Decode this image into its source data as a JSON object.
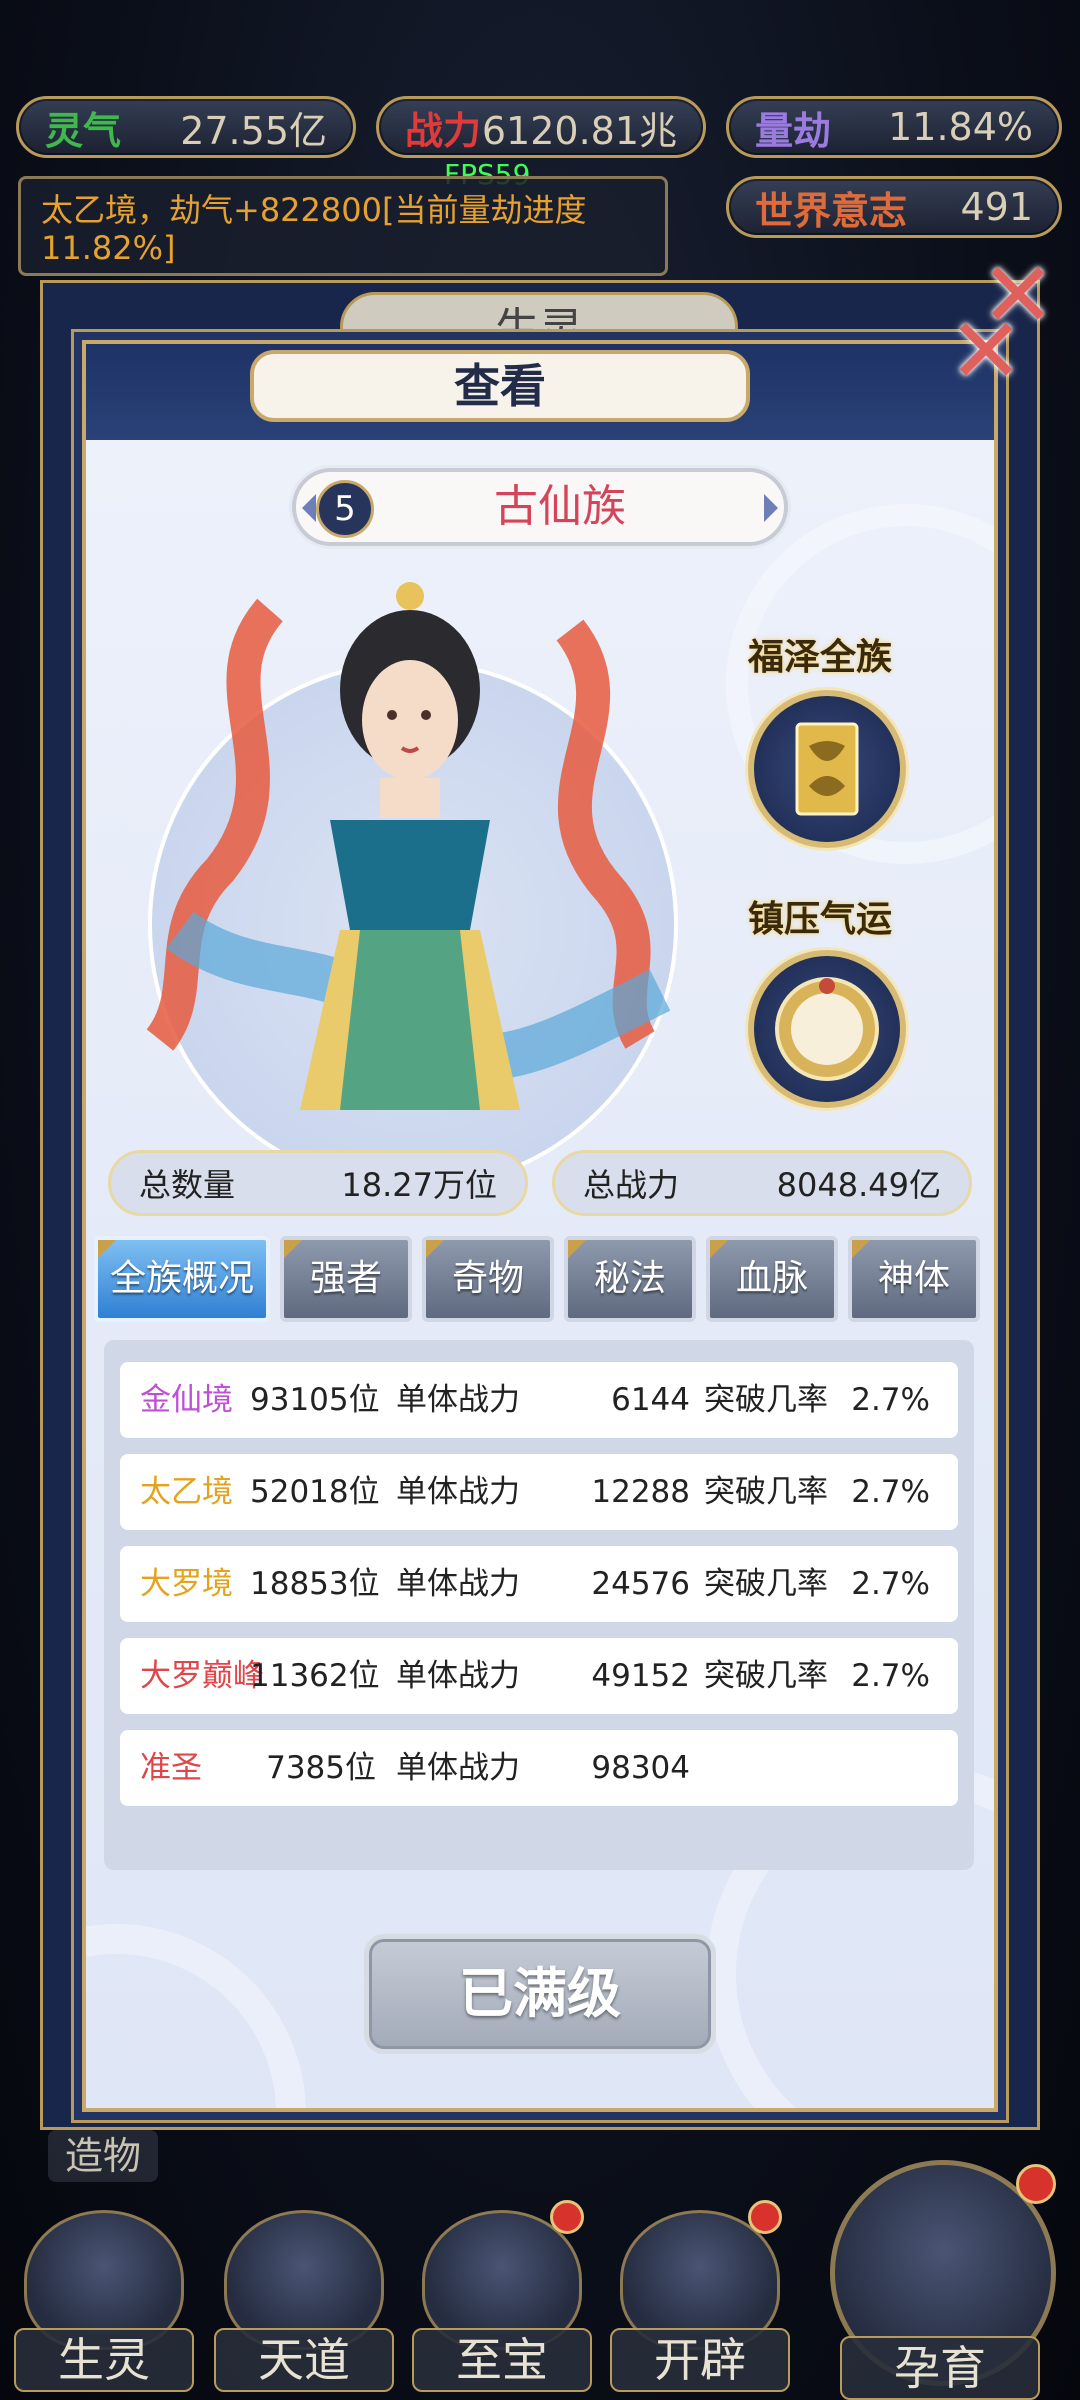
{
  "topbar": {
    "lingqi": {
      "label": "灵气",
      "value": "27.55亿",
      "color": "#3fb84c"
    },
    "zhanli": {
      "label": "战力",
      "value": "6120.81兆",
      "color": "#e03a3a"
    },
    "liangjie": {
      "label": "量劫",
      "value": "11.84%",
      "color": "#9b7be0"
    },
    "shijie": {
      "label": "世界意志",
      "value": "491",
      "color": "#e06b3a"
    }
  },
  "fps": "FPS59",
  "notice": "太乙境，劫气+822800[当前量劫进度11.82%]",
  "background_tab": "生灵",
  "dialog": {
    "title": "查看",
    "race_number": "5",
    "race_name": "古仙族",
    "buffs": [
      {
        "label": "福泽全族",
        "icon": "golden-book-icon"
      },
      {
        "label": "镇压气运",
        "icon": "golden-mirror-icon"
      }
    ],
    "totals": {
      "count_label": "总数量",
      "count_value": "18.27万位",
      "power_label": "总战力",
      "power_value": "8048.49亿"
    },
    "tabs": [
      "全族概况",
      "强者",
      "奇物",
      "秘法",
      "血脉",
      "神体"
    ],
    "active_tab": "全族概况",
    "rows": [
      {
        "realm": "金仙境",
        "realm_color": "#c04fd6",
        "count": "93105位",
        "power_label": "单体战力",
        "power": "6144",
        "break_label": "突破几率",
        "rate": "2.7%"
      },
      {
        "realm": "太乙境",
        "realm_color": "#e5a21d",
        "count": "52018位",
        "power_label": "单体战力",
        "power": "12288",
        "break_label": "突破几率",
        "rate": "2.7%"
      },
      {
        "realm": "大罗境",
        "realm_color": "#e5a21d",
        "count": "18853位",
        "power_label": "单体战力",
        "power": "24576",
        "break_label": "突破几率",
        "rate": "2.7%"
      },
      {
        "realm": "大罗巅峰",
        "realm_color": "#e0454a",
        "count": "11362位",
        "power_label": "单体战力",
        "power": "49152",
        "break_label": "突破几率",
        "rate": "2.7%"
      },
      {
        "realm": "准圣",
        "realm_color": "#e0454a",
        "count": "7385位",
        "power_label": "单体战力",
        "power": "98304",
        "break_label": "",
        "rate": ""
      }
    ],
    "maxed_button": "已满级"
  },
  "side_label": "造物",
  "bottom_nav": [
    {
      "label": "生灵",
      "icon": "phoenix-icon",
      "badge": false
    },
    {
      "label": "天道",
      "icon": "swirl-icon",
      "badge": false
    },
    {
      "label": "至宝",
      "icon": "treasure-icon",
      "badge": true
    },
    {
      "label": "开辟",
      "icon": "mountain-icon",
      "badge": true
    },
    {
      "label": "孕育",
      "icon": "embryo-icon",
      "badge": true
    }
  ]
}
